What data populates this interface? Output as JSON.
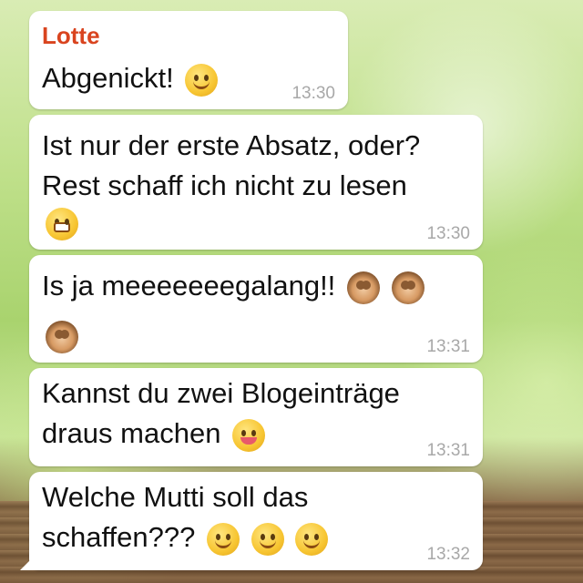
{
  "messages": [
    {
      "sender": "Lotte",
      "lines": [
        "Abgenickt!"
      ],
      "emojis": [
        "smile-emoji"
      ],
      "time": "13:30"
    },
    {
      "lines": [
        "Ist nur der erste Absatz, oder?",
        "Rest schaff ich nicht zu lesen"
      ],
      "emojis": [
        "grin-emoji"
      ],
      "time": "13:30"
    },
    {
      "lines": [
        "Is ja meeeeeeegalang!!"
      ],
      "emojis": [
        "see-no-evil-monkey-emoji",
        "see-no-evil-monkey-emoji",
        "see-no-evil-monkey-emoji"
      ],
      "time": "13:31"
    },
    {
      "lines": [
        "Kannst du zwei Blogeinträge",
        "draus machen"
      ],
      "emojis": [
        "winking-tongue-emoji"
      ],
      "time": "13:31"
    },
    {
      "lines": [
        "Welche Mutti soll das",
        "schaffen???"
      ],
      "emojis": [
        "wink-emoji",
        "wink-emoji",
        "wink-emoji"
      ],
      "time": "13:32"
    }
  ],
  "colors": {
    "sender": "#d9441f",
    "timestamp": "#a8a8a8",
    "bubble": "#ffffff"
  }
}
